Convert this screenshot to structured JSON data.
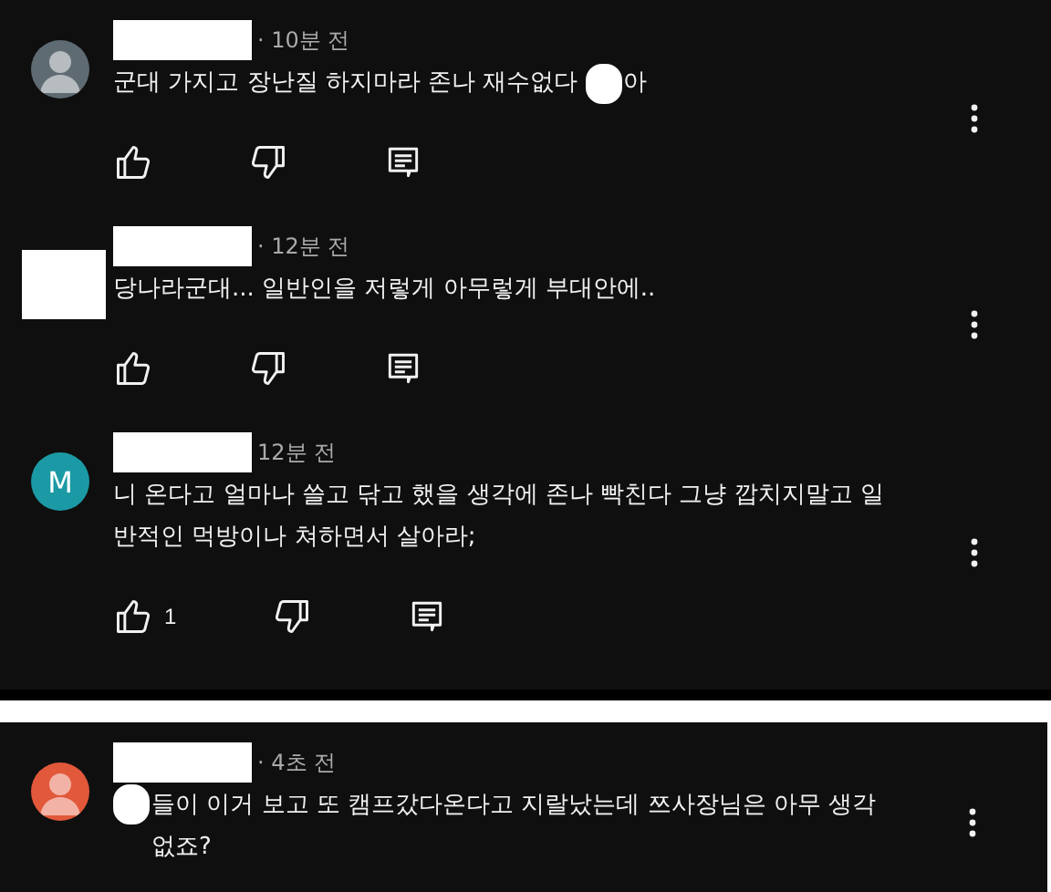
{
  "sections": [
    {
      "comments": [
        {
          "avatar": {
            "kind": "default",
            "color": "#5f6b73"
          },
          "time": "· 10분 전",
          "text": [
            {
              "kind": "text",
              "value": "군대 가지고 장난질 하지마라 존나 재수없다"
            },
            {
              "kind": "redacted"
            },
            {
              "kind": "text",
              "value": "아"
            }
          ],
          "show_actions": true
        },
        {
          "avatar": {
            "kind": "redacted"
          },
          "time": "· 12분 전",
          "text": [
            {
              "kind": "text",
              "value": "당나라군대... 일반인을 저렇게 아무렇게 부대안에.."
            }
          ],
          "show_actions": true
        },
        {
          "avatar": {
            "kind": "letter",
            "letter": "M",
            "color": "#1b9aa5"
          },
          "time": "12분 전",
          "text": [
            {
              "kind": "text",
              "value": "니 온다고 얼마나 쓸고 닦고 했을 생각에 존나 빡친다 그냥 깝치지말고 일반적인 먹방이나 쳐하면서 살아라;"
            }
          ],
          "show_actions": true,
          "like_count": "1"
        }
      ]
    },
    {
      "comments": [
        {
          "avatar": {
            "kind": "default",
            "color": "#e2583a"
          },
          "time": "· 4초 전",
          "text": [
            {
              "kind": "redacted"
            },
            {
              "kind": "text",
              "value": "들이 이거 보고 또 캠프갔다온다고 지랄났는데 쯔사장님은 아무 생각없죠?"
            }
          ],
          "show_actions": false
        }
      ]
    }
  ]
}
